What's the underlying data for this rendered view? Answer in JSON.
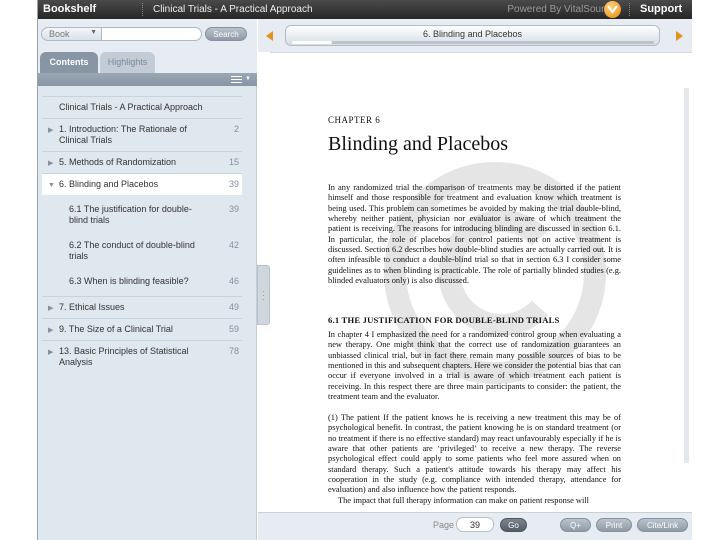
{
  "topbar": {
    "brand": "Bookshelf",
    "book_title": "Clinical Trials - A Practical Approach",
    "powered_by": "Powered By VitalSource",
    "support": "Support"
  },
  "sidebar": {
    "search_scope": "Book",
    "search_placeholder": "",
    "search_button": "Search",
    "tabs": [
      {
        "label": "Contents",
        "active": true
      },
      {
        "label": "Highlights",
        "active": false
      }
    ],
    "toc": [
      {
        "label": "Clinical Trials - A Practical Approach",
        "page": "",
        "arrow": ""
      },
      {
        "label": "1. Introduction: The Rationale of Clinical Trials",
        "page": "2",
        "arrow": "▶"
      },
      {
        "label": "5. Methods of Randomization",
        "page": "15",
        "arrow": "▶"
      },
      {
        "label": "6. Blinding and Placebos",
        "page": "39",
        "arrow": "▼"
      },
      {
        "label": "6.1 The justification for double-blind trials",
        "page": "39",
        "arrow": ""
      },
      {
        "label": "6.2 The conduct of double-blind trials",
        "page": "42",
        "arrow": ""
      },
      {
        "label": "6.3 When is blinding feasible?",
        "page": "46",
        "arrow": ""
      },
      {
        "label": "7. Ethical Issues",
        "page": "49",
        "arrow": "▶"
      },
      {
        "label": "9. The Size of a Clinical Trial",
        "page": "59",
        "arrow": "▶"
      },
      {
        "label": "13. Basic Principles of Statistical Analysis",
        "page": "78",
        "arrow": "▶"
      }
    ]
  },
  "reader": {
    "chapter_pill_title": "6. Blinding and Placebos",
    "progress_fraction": 0.11,
    "page": {
      "chapter_label": "CHAPTER 6",
      "chapter_heading": "Blinding and Placebos",
      "para1": "In any randomized trial the comparison of treatments may be distorted if the patient himself and those responsible for treatment and evaluation know which treatment is being used. This problem can sometimes be avoided by making the trial double-blind, whereby neither patient, physician nor evaluator is aware of which treatment the patient is receiving. The reasons for introducing blinding are discussed in section 6.1. In particular, the role of placebos for control patients not on active treatment is discussed. Section 6.2 describes how double-blind studies are actually carried out. It is often infeasible to conduct a double-blind trial so that in section 6.3 I consider some guidelines as to when blinding is practicable. The role of partially blinded studies (e.g. blinded evaluators only) is also discussed.",
      "section_heading": "6.1 THE JUSTIFICATION FOR DOUBLE-BLIND TRIALS",
      "para2": "In chapter 4 I emphasized the need for a randomized control group when evaluating a new therapy. One might think that the correct use of randomization guarantees an unbiassed clinical trial, but in fact there remain many possible sources of bias to be mentioned in this and subsequent chapters. Here we consider the potential bias that can occur if everyone involved in a trial is aware of which treatment each patient is receiving. In this respect there are three main participants to consider: the patient, the treatment team and the evaluator.",
      "para3": "(1) The patient   If the patient knows he is receiving a new treatment this may be of psychological benefit. In contrast, the patient knowing he is on standard treatment (or no treatment if there is no effective standard) may react unfavourably especially if he is aware that other patients are ‘privileged’ to receive a new therapy. The reverse psychological effect could apply to some patients who feel more assured when on standard therapy. Such a patient's attitude towards his therapy may affect his cooperation in the study (e.g. compliance with intended therapy, attendance for evaluation) and also influence how the patient responds.",
      "para3_tail": "The impact that full therapy information can make on patient response will"
    },
    "footer": {
      "page_label": "Page",
      "page_value": "39",
      "go": "Go",
      "zoom": "Q+",
      "print": "Print",
      "cite": "Cite/Link"
    }
  },
  "colors": {
    "accent_orange": "#e0951a",
    "sidebar_bg": "#dfe7ef",
    "tab_active": "#8795a4",
    "topbar_bg": "#262626"
  }
}
